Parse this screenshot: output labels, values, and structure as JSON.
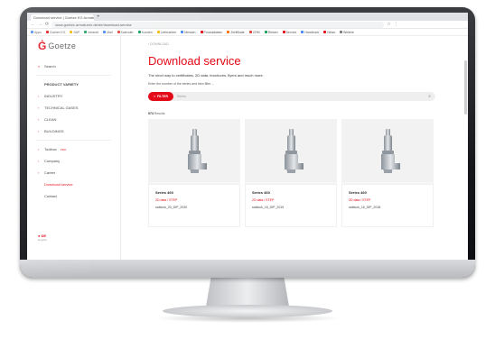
{
  "browser": {
    "tab_title": "Download service | Goetze KG Armaturen",
    "new_tab": "+",
    "url": "www.goetze-armaturen.de/de/download-service",
    "bookmarks": [
      {
        "label": "Apps",
        "color": "#4285f4"
      },
      {
        "label": "Goetze KG",
        "color": "#e30613"
      },
      {
        "label": "SAP",
        "color": "#f4b400"
      },
      {
        "label": "Intranet",
        "color": "#0f9d58"
      },
      {
        "label": "Mail",
        "color": "#4285f4"
      },
      {
        "label": "Kalender",
        "color": "#db4437"
      },
      {
        "label": "Kunden",
        "color": "#0f9d58"
      },
      {
        "label": "Lieferanten",
        "color": "#f4b400"
      },
      {
        "label": "Messen",
        "color": "#4285f4"
      },
      {
        "label": "Produktdaten",
        "color": "#e30613"
      },
      {
        "label": "Zertifikate",
        "color": "#ff6d00"
      },
      {
        "label": "CRM",
        "color": "#db4437"
      },
      {
        "label": "Reisen",
        "color": "#0f9d58"
      },
      {
        "label": "Service",
        "color": "#e30613"
      },
      {
        "label": "Handbuch",
        "color": "#4285f4"
      },
      {
        "label": "News",
        "color": "#e30613"
      },
      {
        "label": "Weitere",
        "color": "#777777"
      }
    ]
  },
  "brand": {
    "mark": "Ġ",
    "name": "Goetze"
  },
  "sidebar": {
    "search": "Search",
    "product_variety": "PRODUCT VARIETY",
    "industry": "INDUSTRY",
    "technical_gases": "TECHNICAL GASES",
    "clean": "CLEAN",
    "buildings": "BUILDINGS",
    "toolbox": "Toolbox",
    "toolbox_badge": "PRO",
    "company": "Company",
    "career": "Career",
    "download_service": "Download service",
    "contact": "Contact",
    "language": "DE",
    "language_sub": "English"
  },
  "main": {
    "breadcrumb": "‹ DOWNLOAD",
    "title": "Download service",
    "subtitle": "The short way to certificates, 2D data, brochures, flyers and much more.",
    "hint": "Enter the number of the series and then filter ...",
    "filter_label": "FILTER",
    "search_placeholder": "Series",
    "results_count": "974",
    "results_label": "Results"
  },
  "cards": [
    {
      "name": "Series 460",
      "badge": "2D data / STEP",
      "code": "sablock_20_DIP_2020"
    },
    {
      "name": "Series 460",
      "badge": "2D data / STEP",
      "code": "sablock_16_DIP_2019"
    },
    {
      "name": "Series 460",
      "badge": "2D data / STEP",
      "code": "sablock_16_DIP_2018"
    }
  ],
  "colors": {
    "accent": "#e30613",
    "monitor": "#15161a",
    "stand": "#c8cacd"
  }
}
